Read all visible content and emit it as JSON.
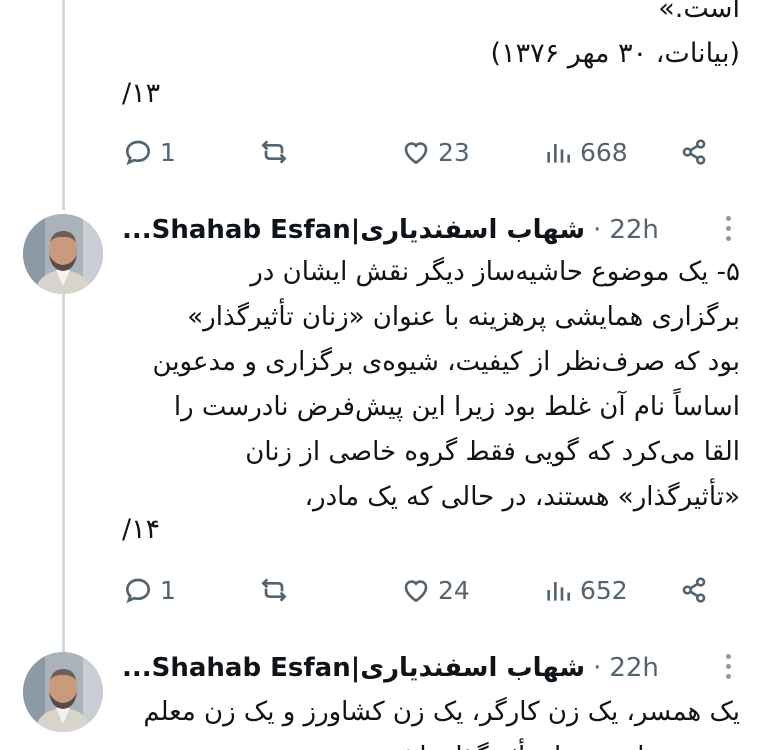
{
  "prev_tweet": {
    "lines": [
      "است.»",
      "(بیانات، ۳۰ مهر ۱۳۷۶)"
    ],
    "counter": "۱۳/",
    "actions": {
      "replies": "1",
      "reposts": "",
      "likes": "23",
      "views": "668"
    }
  },
  "tweets": [
    {
      "author": "شهاب اسفندیاری|Shahab Esfan...",
      "separator": "·",
      "time": "22h",
      "lines": [
        "۵- یک موضوع حاشیه‌ساز دیگر نقش ایشان در",
        "برگزاری همایشی پرهزینه با عنوان «زنان تأثیرگذار»",
        "بود که صرف‌نظر از کیفیت، شیوه‌ی برگزاری و مدعوین",
        "اساساً نام آن غلط بود زیرا این پیش‌فرض نادرست را",
        "القا می‌کرد که گویی فقط گروه خاصی از زنان",
        "«تأثیرگذار» هستند، در حالی که یک مادر،"
      ],
      "counter": "۱۴/",
      "actions": {
        "replies": "1",
        "reposts": "",
        "likes": "24",
        "views": "652"
      }
    },
    {
      "author": "شهاب اسفندیاری|Shahab Esfan...",
      "separator": "·",
      "time": "22h",
      "lines": [
        "یک همسر، یک زن کارگر، یک زن کشاورز و یک زن معلم",
        "هم می‌توانند بسیار تأثیرگذار باشند."
      ]
    }
  ],
  "icons": {
    "reply": "reply-bubble-icon",
    "repost": "repost-arrows-icon",
    "like": "heart-icon",
    "views": "bar-chart-icon",
    "share": "share-icon",
    "more": "more-dots-icon"
  },
  "colors": {
    "text": "#0f1419",
    "muted": "#536471",
    "thread_line": "#cfd9de"
  }
}
